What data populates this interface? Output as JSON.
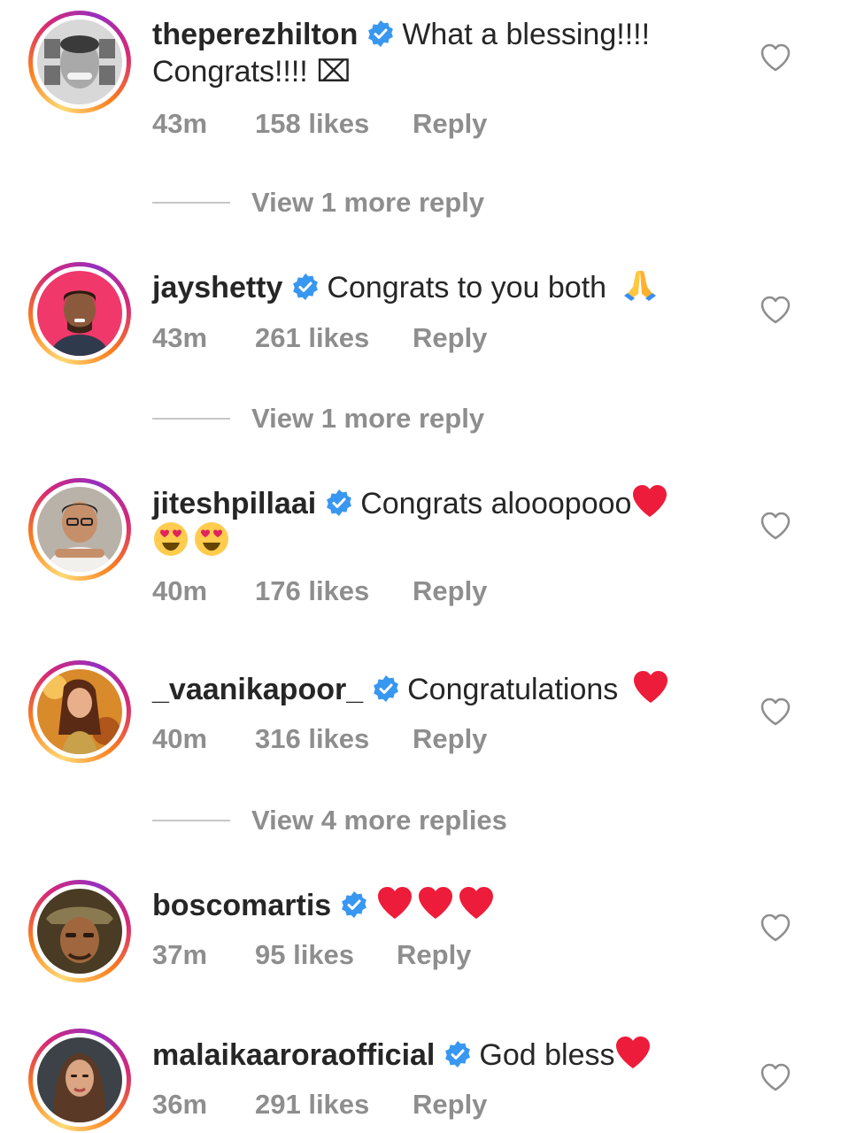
{
  "comments": [
    {
      "username": "theperezhilton",
      "text1": "What a blessing!!!!",
      "text2": "Congrats!!!! ⌧",
      "time": "43m",
      "likes": "158 likes",
      "reply": "Reply",
      "view_more": "View 1 more reply"
    },
    {
      "username": "jayshetty",
      "text1": "Congrats to you both",
      "time": "43m",
      "likes": "261 likes",
      "reply": "Reply",
      "view_more": "View 1 more reply"
    },
    {
      "username": "jiteshpillaai",
      "text1": "Congrats alooopooo",
      "time": "40m",
      "likes": "176 likes",
      "reply": "Reply"
    },
    {
      "username": "_vaanikapoor_",
      "text1": "Congratulations",
      "time": "40m",
      "likes": "316 likes",
      "reply": "Reply",
      "view_more": "View 4 more replies"
    },
    {
      "username": "boscomartis",
      "text1": "",
      "time": "37m",
      "likes": "95 likes",
      "reply": "Reply"
    },
    {
      "username": "malaikaaroraofficial",
      "text1": "God bless",
      "time": "36m",
      "likes": "291 likes",
      "reply": "Reply"
    }
  ],
  "icons": {
    "verified": "verified-badge-icon",
    "like": "heart-outline-icon",
    "pray": "folded-hands-emoji",
    "heart": "red-heart-emoji",
    "heart_eyes": "heart-eyes-emoji"
  },
  "colors": {
    "verified_blue": "#3897f0",
    "muted": "#8e8e8e",
    "text": "#262626",
    "heart_red": "#ed1c3a"
  }
}
